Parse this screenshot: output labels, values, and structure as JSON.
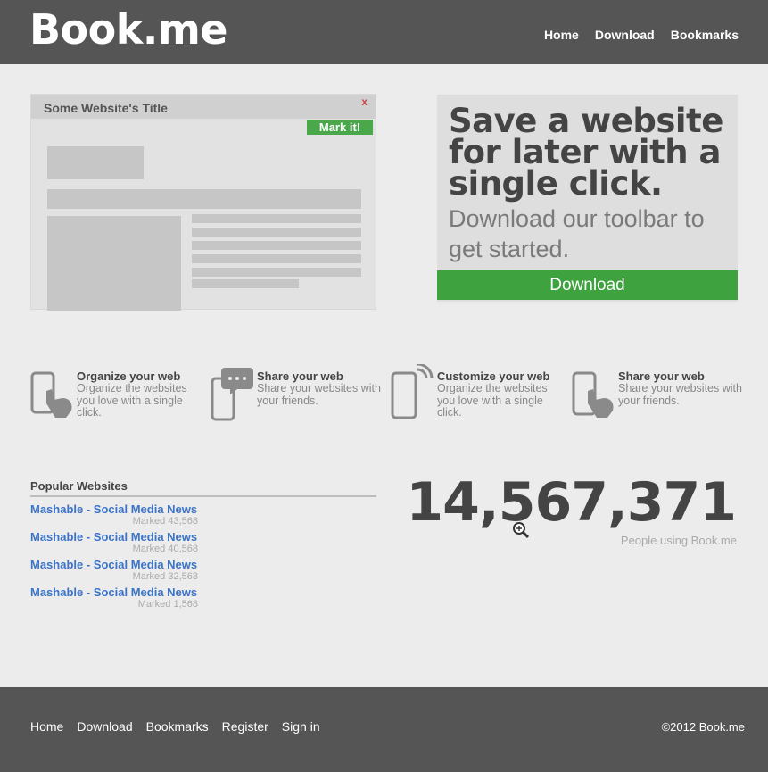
{
  "header": {
    "logo": "Book.me",
    "nav": [
      "Home",
      "Download",
      "Bookmarks"
    ]
  },
  "mock_browser": {
    "title": "Some Website's Title",
    "close": "x",
    "mark_button": "Mark it!"
  },
  "promo": {
    "headline": "Save a website for later with a single click.",
    "subtext": "Download our toolbar to get started.",
    "button": "Download"
  },
  "features": [
    {
      "title": "Organize your web",
      "desc": "Organize the websites you love with a single click.",
      "icon": "tap-phone-icon"
    },
    {
      "title": "Share your web",
      "desc": "Share your websites with your friends.",
      "icon": "chat-phone-icon"
    },
    {
      "title": "Customize your web",
      "desc": "Organize the websites you love with a single click.",
      "icon": "signal-phone-icon"
    },
    {
      "title": "Share your web",
      "desc": "Share your websites with your friends.",
      "icon": "tap-phone-icon"
    }
  ],
  "popular": {
    "title": "Popular Websites",
    "items": [
      {
        "name": "Mashable - Social Media News",
        "count": "Marked 43,568"
      },
      {
        "name": "Mashable - Social Media News",
        "count": "Marked 40,568"
      },
      {
        "name": "Mashable - Social Media News",
        "count": "Marked 32,568"
      },
      {
        "name": "Mashable - Social Media News",
        "count": "Marked 1,568"
      }
    ]
  },
  "stats": {
    "number": "14,567,371",
    "caption": "People using Book.me"
  },
  "footer": {
    "nav": [
      "Home",
      "Download",
      "Bookmarks",
      "Register",
      "Sign in"
    ],
    "copyright": "©2012 Book.me"
  },
  "colors": {
    "header_bg": "#555555",
    "accent_green": "#3ea33e",
    "link_blue": "#3c74c7",
    "page_bg": "#ececec"
  }
}
